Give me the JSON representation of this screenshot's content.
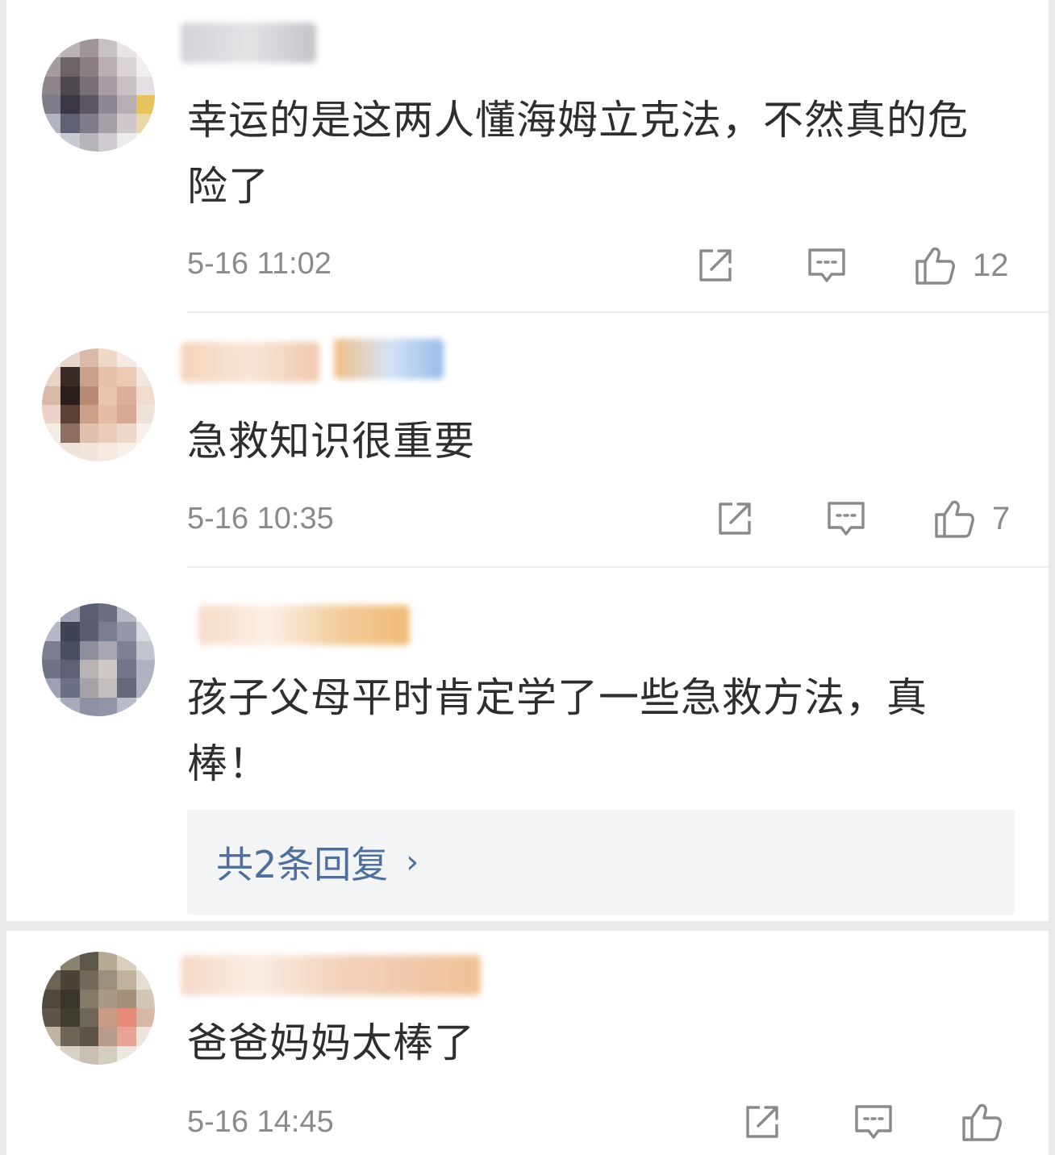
{
  "comments": [
    {
      "text": "幸运的是这两人懂海姆立克法，不然真的危险了",
      "time": "5-16 11:02",
      "likes": "12",
      "share_icon": "share-icon",
      "comment_icon": "comment-icon",
      "like_icon": "thumbs-up-icon"
    },
    {
      "text": "急救知识很重要",
      "time": "5-16 10:35",
      "likes": "7",
      "share_icon": "share-icon",
      "comment_icon": "comment-icon",
      "like_icon": "thumbs-up-icon"
    },
    {
      "text": "孩子父母平时肯定学了一些急救方法，真棒！",
      "replies_label": "共2条回复",
      "replies_chevron": "›"
    },
    {
      "text": "爸爸妈妈太棒了",
      "time": "5-16 14:45",
      "share_icon": "share-icon",
      "comment_icon": "comment-icon",
      "like_icon": "thumbs-up-icon"
    }
  ],
  "colors": {
    "background": "#e9e9ec",
    "card": "#ffffff",
    "text": "#2e2e2e",
    "muted": "#8a8a8a",
    "link": "#4e6f9e",
    "reply_bg": "#f3f4f6"
  }
}
